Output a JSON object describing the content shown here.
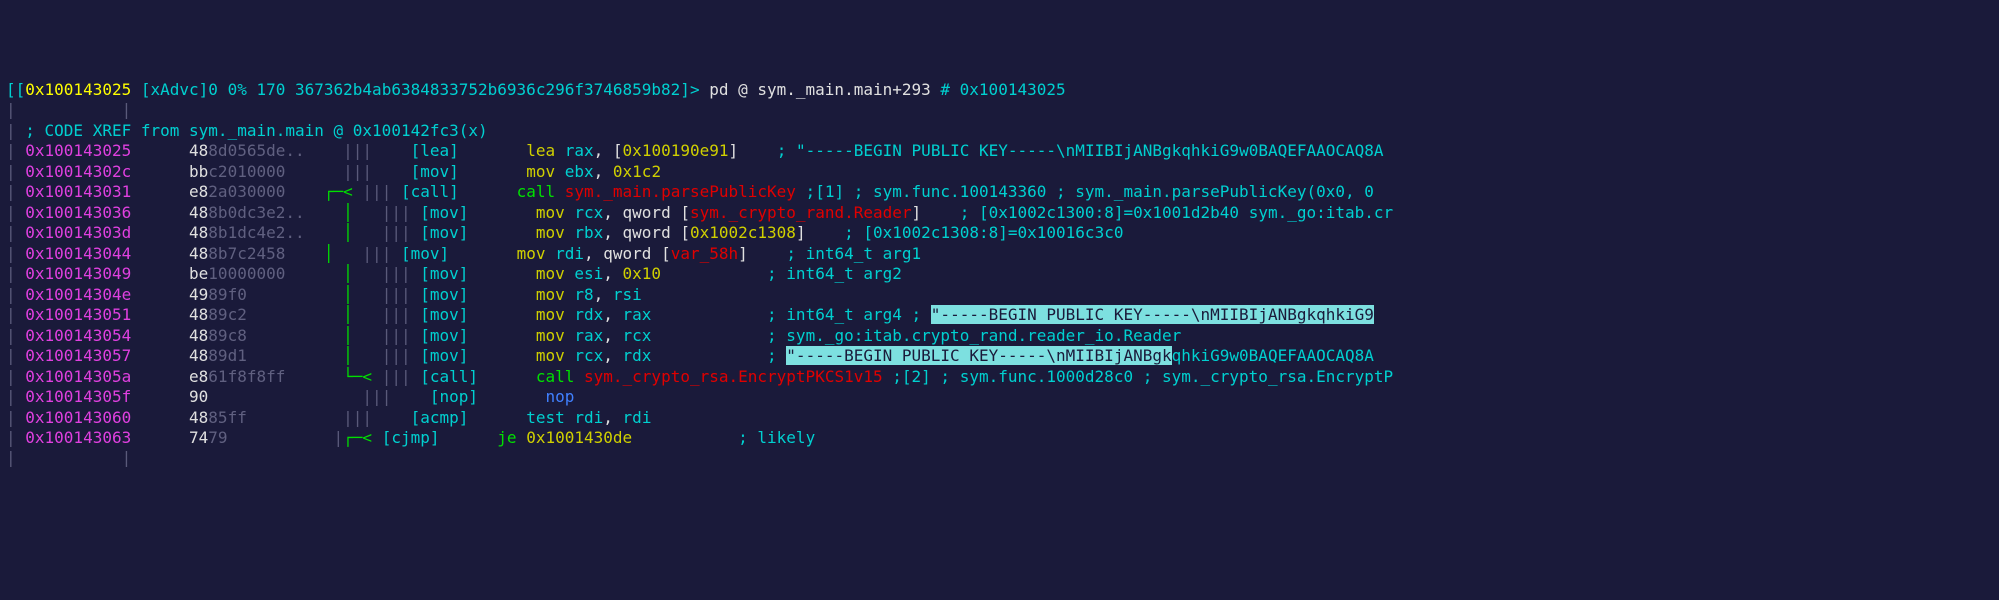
{
  "prompt": {
    "open": "[[",
    "addr": "0x100143025",
    "flags": "[xAdvc]0 0% 170 367362b4ab6384833752b6936c296f3746859b82]>",
    "cmd": "pd @ sym._main.main+293",
    "comment": "# 0x100143025"
  },
  "sep_row": "|           |",
  "xref": "; CODE XREF from sym._main.main @ 0x100142fc3(x)",
  "rows": [
    {
      "addr": "0x100143025",
      "hexA": "48",
      "hexD": "8d0565de..",
      "graph": "    ||| ",
      "g2": "   ",
      "br": "[lea]  ",
      "m": "lea",
      "mclass": "mnem-data",
      "args": [
        [
          "reg",
          "rax"
        ],
        [
          "plain",
          ", "
        ],
        [
          "plain",
          "["
        ],
        [
          "num",
          "0x100190e91"
        ],
        [
          "plain",
          "]"
        ]
      ],
      "c": "    ; \"-----BEGIN PUBLIC KEY-----\\nMIIBIjANBgkqhkiG9w0BAQEFAAOCAQ8A"
    },
    {
      "addr": "0x10014302c",
      "hexA": "bb",
      "hexD": "c2010000",
      "graph": "      ||| ",
      "g2": "   ",
      "br": "[mov]  ",
      "m": "mov",
      "mclass": "mnem-data",
      "args": [
        [
          "reg",
          "ebx"
        ],
        [
          "plain",
          ", "
        ],
        [
          "num",
          "0x1c2"
        ]
      ],
      "c": ""
    },
    {
      "addr": "0x100143031",
      "hexA": "e8",
      "hexD": "2a030000",
      "graph": "    ",
      "arrow": "┌─< ",
      "g2": "||| ",
      "br": "[call] ",
      "m": "call",
      "mclass": "mnem-call",
      "args": [
        [
          "callref",
          "sym._main.parsePublicKey"
        ]
      ],
      "c": " ;[1] ; sym.func.100143360 ; sym._main.parsePublicKey(0x0, 0"
    },
    {
      "addr": "0x100143036",
      "hexA": "48",
      "hexD": "8b0dc3e2..",
      "graph": "    ",
      "arrow": "│   ",
      "g2": "||| ",
      "br": "[mov]  ",
      "m": "mov",
      "mclass": "mnem-data",
      "args": [
        [
          "reg",
          "rcx"
        ],
        [
          "plain",
          ", "
        ],
        [
          "plain",
          "qword "
        ],
        [
          "plain",
          "["
        ],
        [
          "memref",
          "sym._crypto_rand.Reader"
        ],
        [
          "plain",
          "]"
        ]
      ],
      "c": "    ; [0x1002c1300:8]=0x1001d2b40 sym._go:itab.cr"
    },
    {
      "addr": "0x10014303d",
      "hexA": "48",
      "hexD": "8b1dc4e2..",
      "graph": "    ",
      "arrow": "│   ",
      "g2": "||| ",
      "br": "[mov]  ",
      "m": "mov",
      "mclass": "mnem-data",
      "args": [
        [
          "reg",
          "rbx"
        ],
        [
          "plain",
          ", "
        ],
        [
          "plain",
          "qword "
        ],
        [
          "plain",
          "["
        ],
        [
          "num",
          "0x1002c1308"
        ],
        [
          "plain",
          "]"
        ]
      ],
      "c": "    ; [0x1002c1308:8]=0x10016c3c0"
    },
    {
      "addr": "0x100143044",
      "hexA": "48",
      "hexD": "8b7c2458",
      "graph": "    ",
      "arrow": "│   ",
      "g2": "||| ",
      "br": "[mov]  ",
      "m": "mov",
      "mclass": "mnem-data",
      "args": [
        [
          "reg",
          "rdi"
        ],
        [
          "plain",
          ", "
        ],
        [
          "plain",
          "qword "
        ],
        [
          "plain",
          "["
        ],
        [
          "memref",
          "var_58h"
        ],
        [
          "plain",
          "]"
        ]
      ],
      "c": "    ; int64_t arg1"
    },
    {
      "addr": "0x100143049",
      "hexA": "be",
      "hexD": "10000000",
      "graph": "      ",
      "arrow": "│   ",
      "g2": "||| ",
      "br": "[mov]  ",
      "m": "mov",
      "mclass": "mnem-data",
      "args": [
        [
          "reg",
          "esi"
        ],
        [
          "plain",
          ", "
        ],
        [
          "num",
          "0x10"
        ]
      ],
      "c": "           ; int64_t arg2"
    },
    {
      "addr": "0x10014304e",
      "hexA": "49",
      "hexD": "89f0",
      "graph": "          ",
      "arrow": "│   ",
      "g2": "||| ",
      "br": "[mov]  ",
      "m": "mov",
      "mclass": "mnem-data",
      "args": [
        [
          "reg",
          "r8"
        ],
        [
          "plain",
          ", "
        ],
        [
          "reg",
          "rsi"
        ]
      ],
      "c": ""
    },
    {
      "addr": "0x100143051",
      "hexA": "48",
      "hexD": "89c2",
      "graph": "          ",
      "arrow": "│   ",
      "g2": "||| ",
      "br": "[mov]  ",
      "m": "mov",
      "mclass": "mnem-data",
      "args": [
        [
          "reg",
          "rdx"
        ],
        [
          "plain",
          ", "
        ],
        [
          "reg",
          "rax"
        ]
      ],
      "c": "            ; int64_t arg4 ; ",
      "hl": "\"-----BEGIN PUBLIC KEY-----\\nMIIBIjANBgkqhkiG9"
    },
    {
      "addr": "0x100143054",
      "hexA": "48",
      "hexD": "89c8",
      "graph": "          ",
      "arrow": "│   ",
      "g2": "||| ",
      "br": "[mov]  ",
      "m": "mov",
      "mclass": "mnem-data",
      "args": [
        [
          "reg",
          "rax"
        ],
        [
          "plain",
          ", "
        ],
        [
          "reg",
          "rcx"
        ]
      ],
      "c": "            ; sym._go:itab.crypto_rand.reader_io.Reader"
    },
    {
      "addr": "0x100143057",
      "hexA": "48",
      "hexD": "89d1",
      "graph": "          ",
      "arrow": "│   ",
      "g2": "||| ",
      "br": "[mov]  ",
      "m": "mov",
      "mclass": "mnem-data",
      "args": [
        [
          "reg",
          "rcx"
        ],
        [
          "plain",
          ", "
        ],
        [
          "reg",
          "rdx"
        ]
      ],
      "c": "            ; ",
      "hl": "\"-----BEGIN PUBLIC KEY-----\\nMIIBIjANBgk",
      "c2": "qhkiG9w0BAQEFAAOCAQ8A"
    },
    {
      "addr": "0x10014305a",
      "hexA": "e8",
      "hexD": "61f8f8ff",
      "graph": "      ",
      "arrow": "└─< ",
      "g2": "||| ",
      "br": "[call] ",
      "m": "call",
      "mclass": "mnem-call",
      "args": [
        [
          "callref",
          "sym._crypto_rsa.EncryptPKCS1v15"
        ]
      ],
      "c": " ;[2] ; sym.func.1000d28c0 ; sym._crypto_rsa.EncryptP"
    },
    {
      "addr": "0x10014305f",
      "hexA": "90",
      "hexD": "",
      "graph": "                ||| ",
      "g2": "   ",
      "br": "[nop]  ",
      "m": "nop",
      "mclass": "mnem-nop",
      "args": [],
      "c": ""
    },
    {
      "addr": "0x100143060",
      "hexA": "48",
      "hexD": "85ff",
      "graph": "          ||| ",
      "g2": "   ",
      "br": "[acmp] ",
      "m": "test",
      "mclass": "mnem-cmp",
      "args": [
        [
          "reg",
          "rdi"
        ],
        [
          "plain",
          ", "
        ],
        [
          "reg",
          "rdi"
        ]
      ],
      "c": ""
    },
    {
      "addr": "0x100143063",
      "hexA": "74",
      "hexD": "79",
      "graph": "           |",
      "arrow": "┌─< ",
      "g2": "",
      "br": "[cjmp] ",
      "m": "je",
      "mclass": "mnem-jmp",
      "args": [
        [
          "num",
          "0x1001430de"
        ]
      ],
      "c": "           ; likely"
    }
  ],
  "footer": "|           |"
}
